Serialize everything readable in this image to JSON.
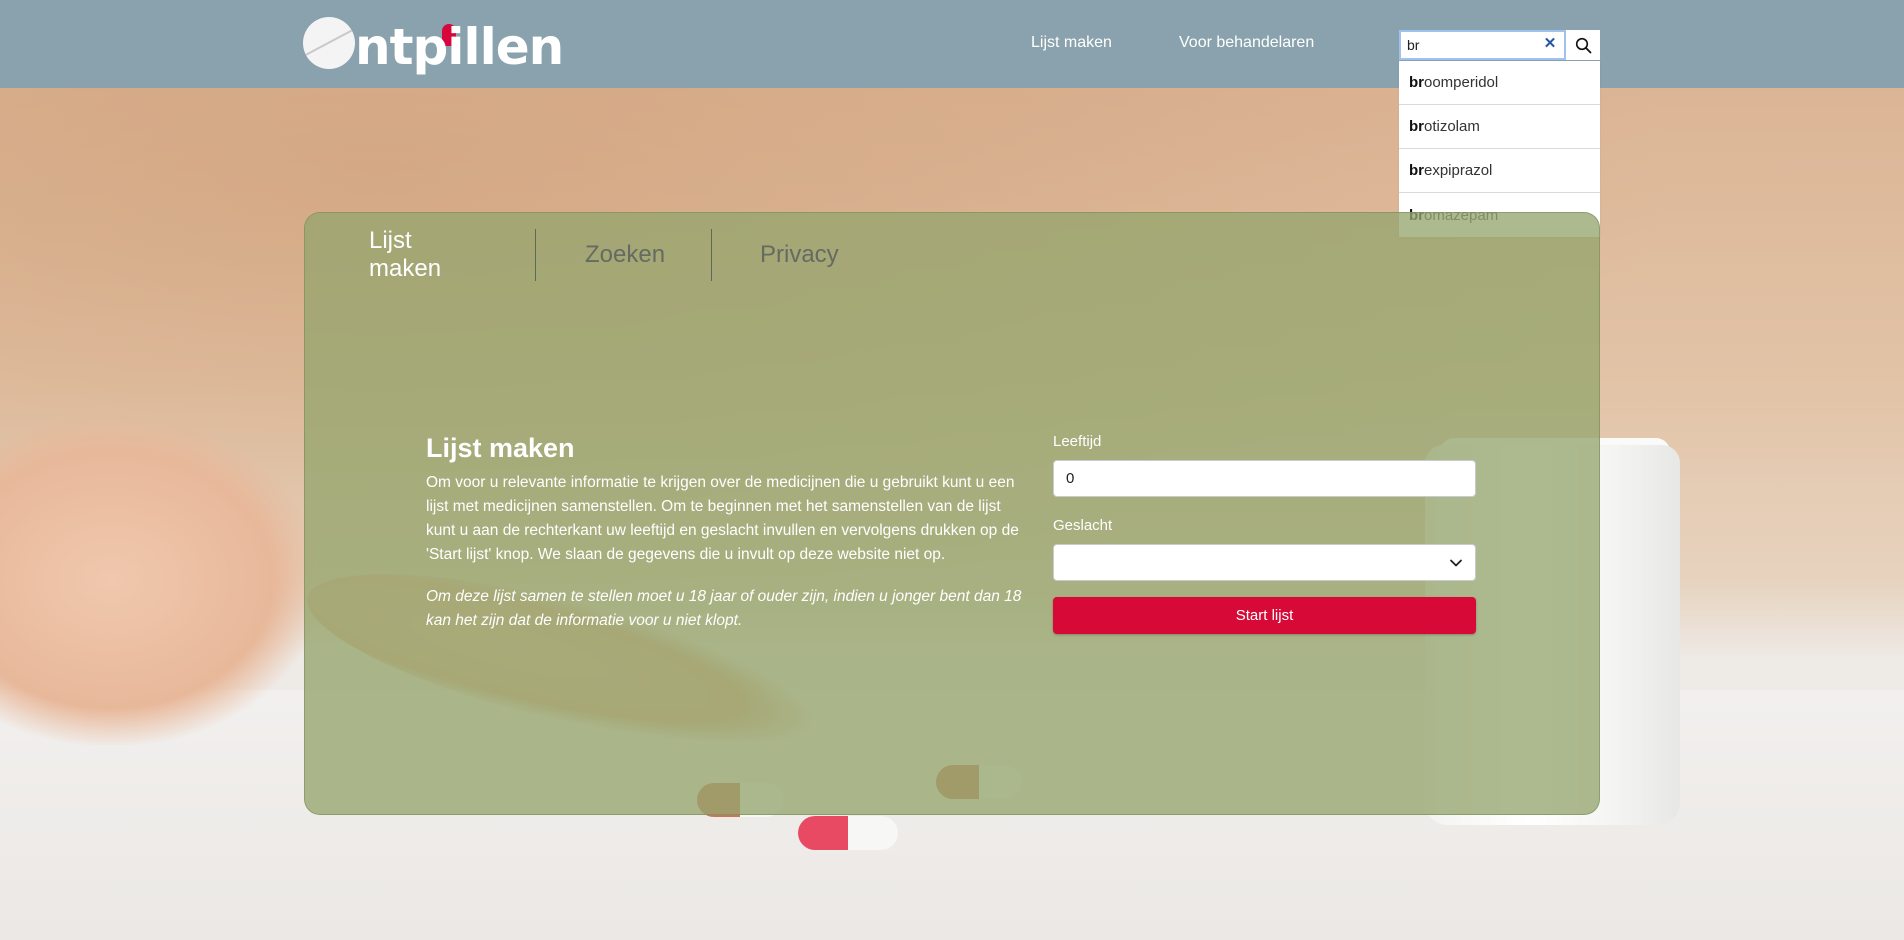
{
  "header": {
    "logo_text": "Ontpillen",
    "nav": [
      {
        "label": "Lijst maken"
      },
      {
        "label": "Voor behandelaren"
      }
    ],
    "search": {
      "value": "br",
      "suggestions": [
        {
          "match": "br",
          "rest": "oomperidol"
        },
        {
          "match": "br",
          "rest": "otizolam"
        },
        {
          "match": "br",
          "rest": "expiprazol"
        },
        {
          "match": "br",
          "rest": "omazepam"
        }
      ]
    }
  },
  "tabs": [
    {
      "label": "Lijst maken",
      "active": true
    },
    {
      "label": "Zoeken",
      "active": false
    },
    {
      "label": "Privacy",
      "active": false
    }
  ],
  "intro": {
    "title": "Lijst maken",
    "body": "Om voor u relevante informatie te krijgen over de medicijnen die u gebruikt kunt u een lijst met medicijnen samenstellen. Om te beginnen met het samenstellen van de lijst kunt u aan de rechterkant uw leeftijd en geslacht invullen en vervolgens drukken op de 'Start lijst' knop. We slaan de gegevens die u invult op deze website niet op.",
    "note": "Om deze lijst samen te stellen moet u 18 jaar of ouder zijn, indien u jonger bent dan 18 kan het zijn dat de informatie voor u niet klopt."
  },
  "form": {
    "age_label": "Leeftijd",
    "age_value": "0",
    "gender_label": "Geslacht",
    "gender_value": "",
    "submit_label": "Start lijst"
  },
  "colors": {
    "header_bg": "#8aa2ad",
    "panel_bg": "#96a56e",
    "accent": "#d70a37"
  }
}
